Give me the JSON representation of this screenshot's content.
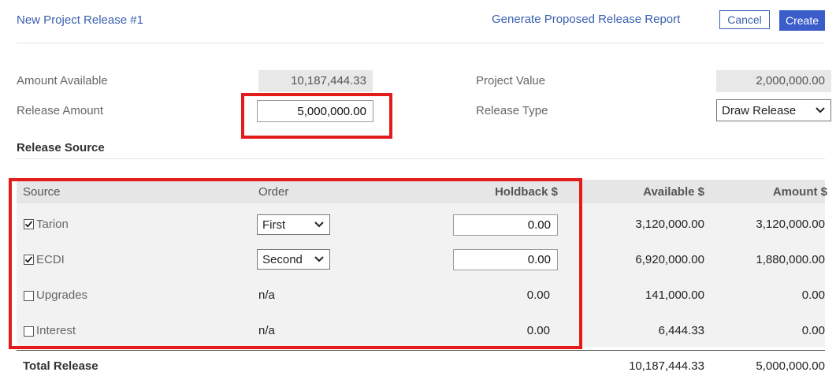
{
  "header": {
    "title": "New Project Release #1",
    "report_link": "Generate Proposed Release Report",
    "cancel": "Cancel",
    "create": "Create"
  },
  "form": {
    "amount_available_label": "Amount Available",
    "amount_available_value": "10,187,444.33",
    "project_value_label": "Project Value",
    "project_value_value": "2,000,000.00",
    "release_amount_label": "Release Amount",
    "release_amount_value": "5,000,000.00",
    "release_type_label": "Release Type",
    "release_type_value": "Draw Release"
  },
  "section": {
    "release_source": "Release Source"
  },
  "table": {
    "headers": {
      "source": "Source",
      "order": "Order",
      "holdback": "Holdback $",
      "available": "Available $",
      "amount": "Amount $"
    },
    "rows": [
      {
        "source": "Tarion",
        "checked": true,
        "order": "First",
        "holdback": "0.00",
        "available": "3,120,000.00",
        "amount": "3,120,000.00"
      },
      {
        "source": "ECDI",
        "checked": true,
        "order": "Second",
        "holdback": "0.00",
        "available": "6,920,000.00",
        "amount": "1,880,000.00"
      },
      {
        "source": "Upgrades",
        "checked": false,
        "order": "n/a",
        "holdback": "0.00",
        "available": "141,000.00",
        "amount": "0.00"
      },
      {
        "source": "Interest",
        "checked": false,
        "order": "n/a",
        "holdback": "0.00",
        "available": "6,444.33",
        "amount": "0.00"
      }
    ],
    "total": {
      "label": "Total Release",
      "available": "10,187,444.33",
      "amount": "5,000,000.00"
    }
  },
  "colors": {
    "link": "#3a5fb0",
    "create_button": "#3b5dc9",
    "highlight": "#e31b1b"
  }
}
